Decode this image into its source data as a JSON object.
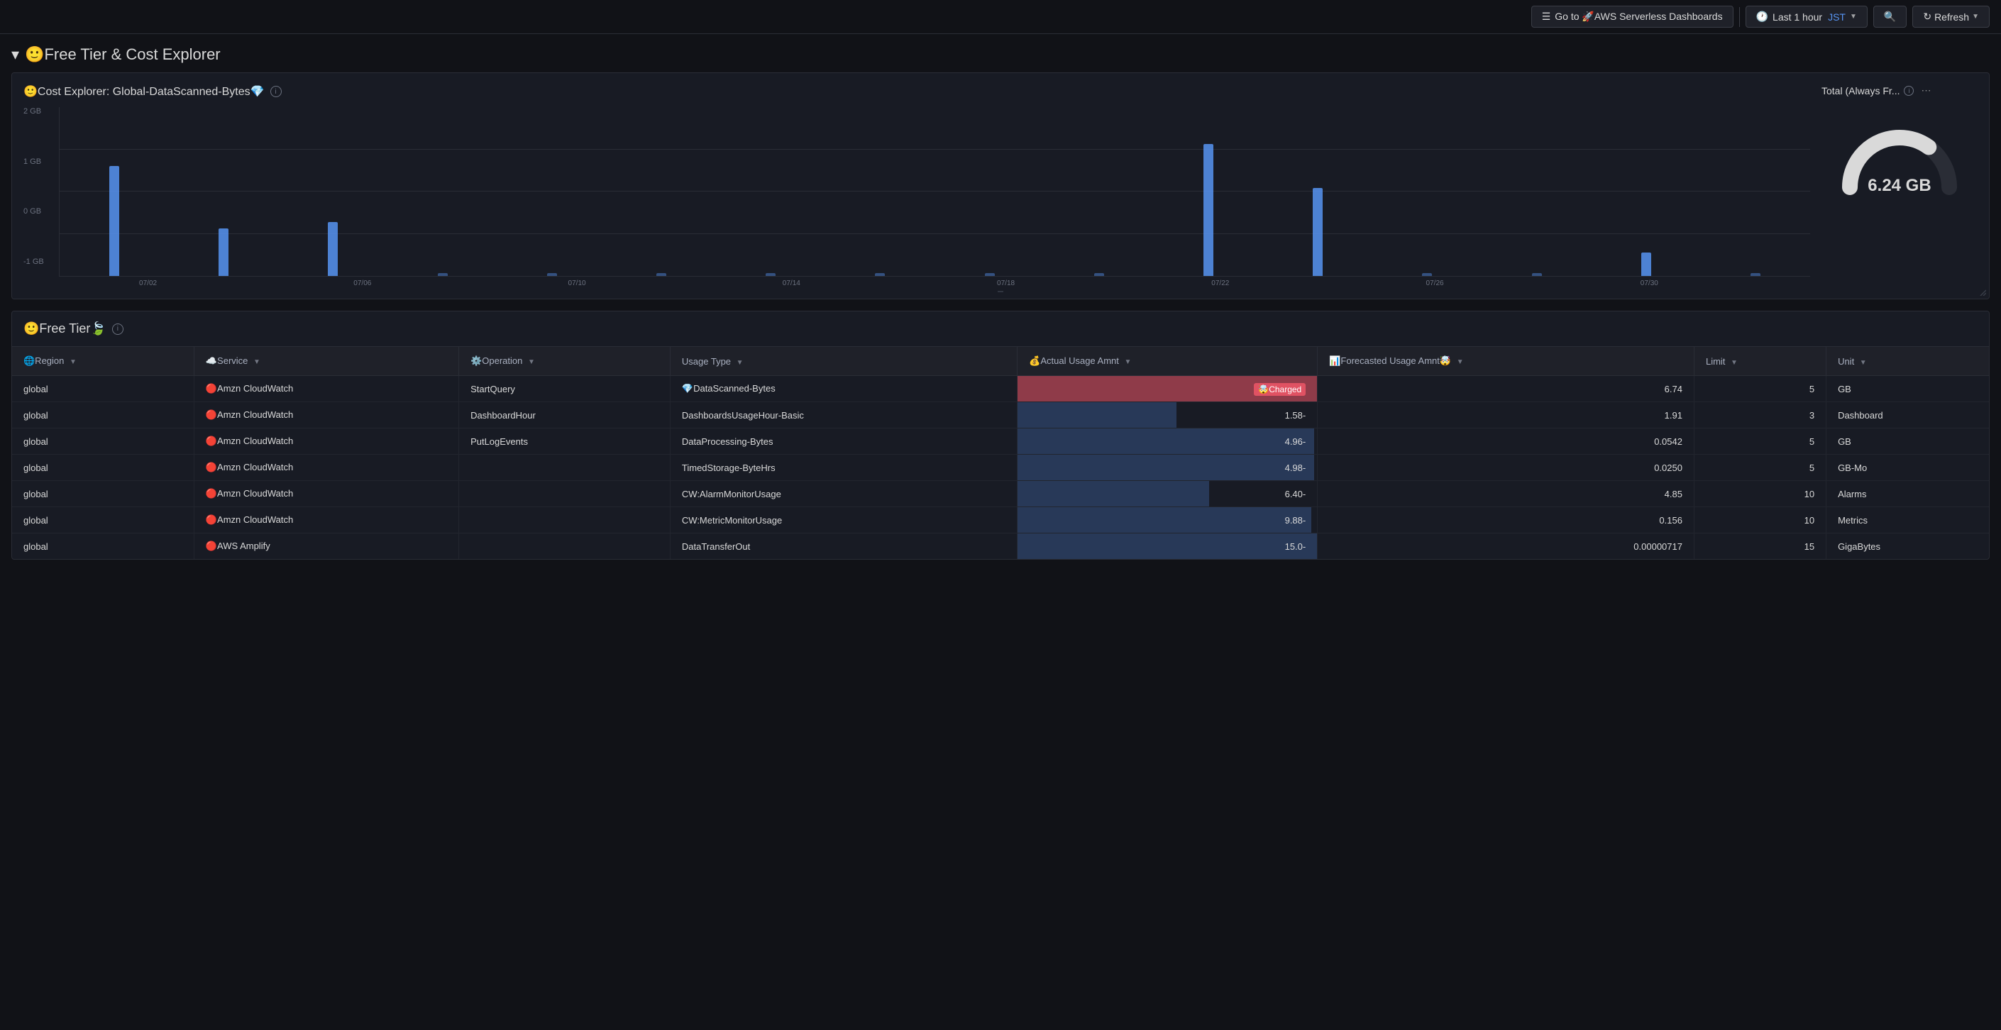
{
  "topbar": {
    "aws_btn_label": "Go to 🚀AWS Serverless Dashboards",
    "time_label": "Last 1 hour",
    "timezone": "JST",
    "refresh_label": "Refresh"
  },
  "page_title": "🙂Free Tier & Cost Explorer",
  "chart_section": {
    "title": "🙂Cost Explorer: Global-DataScanned-Bytes💎",
    "info_tooltip": "i",
    "y_labels": [
      "2 GB",
      "1 GB",
      "0 GB",
      "-1 GB"
    ],
    "x_labels": [
      "07/02",
      "07/06",
      "07/10",
      "07/14",
      "07/18",
      "07/22",
      "07/26",
      "07/30"
    ],
    "gauge": {
      "title": "Total (Always Fr...",
      "value": "6.24 GB"
    }
  },
  "free_tier": {
    "title": "🙂Free Tier🍃",
    "info_tooltip": "i",
    "columns": [
      {
        "label": "🌐Region",
        "key": "region"
      },
      {
        "label": "☁️Service",
        "key": "service"
      },
      {
        "label": "⚙️Operation",
        "key": "operation"
      },
      {
        "label": "Usage Type",
        "key": "usage_type"
      },
      {
        "label": "💰Actual Usage Amnt",
        "key": "actual_usage"
      },
      {
        "label": "📊Forecasted Usage Amnt🤯",
        "key": "forecasted_usage"
      },
      {
        "label": "Limit",
        "key": "limit"
      },
      {
        "label": "Unit",
        "key": "unit"
      }
    ],
    "rows": [
      {
        "region": "global",
        "service": "🔴Amzn CloudWatch",
        "operation": "StartQuery",
        "usage_type": "💎DataScanned-Bytes",
        "actual_usage": "Charged",
        "actual_charged": true,
        "actual_pct": 100,
        "forecasted_usage": "6.74",
        "limit": "5",
        "unit": "GB"
      },
      {
        "region": "global",
        "service": "🔴Amzn CloudWatch",
        "operation": "DashboardHour",
        "usage_type": "DashboardsUsageHour-Basic",
        "actual_usage": "1.58-",
        "actual_charged": false,
        "actual_pct": 53,
        "forecasted_usage": "1.91",
        "limit": "3",
        "unit": "Dashboard"
      },
      {
        "region": "global",
        "service": "🔴Amzn CloudWatch",
        "operation": "PutLogEvents",
        "usage_type": "DataProcessing-Bytes",
        "actual_usage": "4.96-",
        "actual_charged": false,
        "actual_pct": 99,
        "forecasted_usage": "0.0542",
        "limit": "5",
        "unit": "GB"
      },
      {
        "region": "global",
        "service": "🔴Amzn CloudWatch",
        "operation": "",
        "usage_type": "TimedStorage-ByteHrs",
        "actual_usage": "4.98-",
        "actual_charged": false,
        "actual_pct": 99,
        "forecasted_usage": "0.0250",
        "limit": "5",
        "unit": "GB-Mo"
      },
      {
        "region": "global",
        "service": "🔴Amzn CloudWatch",
        "operation": "",
        "usage_type": "CW:AlarmMonitorUsage",
        "actual_usage": "6.40-",
        "actual_charged": false,
        "actual_pct": 64,
        "forecasted_usage": "4.85",
        "limit": "10",
        "unit": "Alarms"
      },
      {
        "region": "global",
        "service": "🔴Amzn CloudWatch",
        "operation": "",
        "usage_type": "CW:MetricMonitorUsage",
        "actual_usage": "9.88-",
        "actual_charged": false,
        "actual_pct": 98,
        "forecasted_usage": "0.156",
        "limit": "10",
        "unit": "Metrics"
      },
      {
        "region": "global",
        "service": "🔴AWS Amplify",
        "operation": "",
        "usage_type": "DataTransferOut",
        "actual_usage": "15.0-",
        "actual_charged": false,
        "actual_pct": 100,
        "forecasted_usage": "0.00000717",
        "limit": "15",
        "unit": "GigaBytes"
      }
    ]
  },
  "bars": [
    {
      "height": 65,
      "label": "07/02"
    },
    {
      "height": 28,
      "label": ""
    },
    {
      "height": 32,
      "label": "07/06"
    },
    {
      "height": 6,
      "label": ""
    },
    {
      "height": 6,
      "label": "07/10"
    },
    {
      "height": 6,
      "label": ""
    },
    {
      "height": 6,
      "label": "07/14"
    },
    {
      "height": 6,
      "label": ""
    },
    {
      "height": 6,
      "label": "07/18"
    },
    {
      "height": 6,
      "label": ""
    },
    {
      "height": 78,
      "label": "07/22"
    },
    {
      "height": 52,
      "label": ""
    },
    {
      "height": 6,
      "label": "07/26"
    },
    {
      "height": 6,
      "label": ""
    },
    {
      "height": 14,
      "label": "07/30"
    },
    {
      "height": 6,
      "label": ""
    }
  ]
}
